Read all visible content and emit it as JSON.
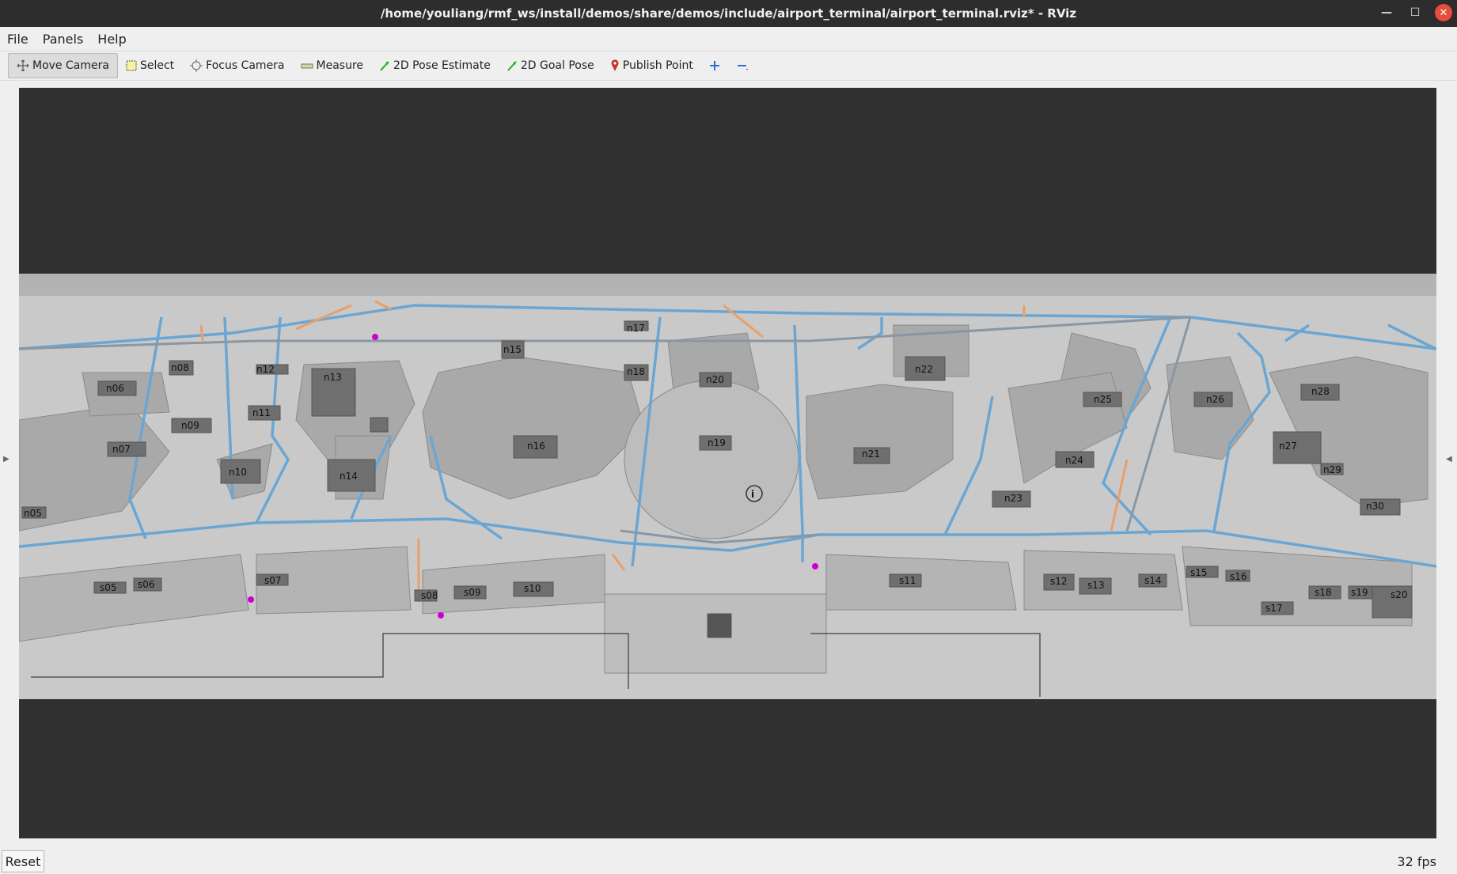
{
  "window": {
    "title": "/home/youliang/rmf_ws/install/demos/share/demos/include/airport_terminal/airport_terminal.rviz* - RViz"
  },
  "menu": [
    "File",
    "Panels",
    "Help"
  ],
  "toolbar": {
    "tools": [
      "Move Camera",
      "Select",
      "Focus Camera",
      "Measure",
      "2D Pose Estimate",
      "2D Goal Pose",
      "Publish Point"
    ],
    "active": "Move Camera"
  },
  "map": {
    "north_labels": [
      "n05",
      "n06",
      "n07",
      "n08",
      "n09",
      "n10",
      "n11",
      "n12",
      "n13",
      "n14",
      "n15",
      "n16",
      "n17",
      "n18",
      "n19",
      "n20",
      "n21",
      "n22",
      "n23",
      "n24",
      "n25",
      "n26",
      "n27",
      "n28",
      "n29",
      "n30"
    ],
    "south_labels": [
      "s05",
      "s06",
      "s07",
      "s08",
      "s09",
      "s10",
      "s11",
      "s12",
      "s13",
      "s14",
      "s15",
      "s16",
      "s17",
      "s18",
      "s19",
      "s20"
    ]
  },
  "status": {
    "reset_label": "Reset",
    "fps": "32 fps"
  },
  "colors": {
    "titlebar": "#2d2d2d",
    "viewport_bg": "#303030",
    "floor": "#c8c8c8",
    "lane_blue": "#6aa6d4",
    "lane_orange": "#e8a06a",
    "marker": "#cc00cc"
  }
}
